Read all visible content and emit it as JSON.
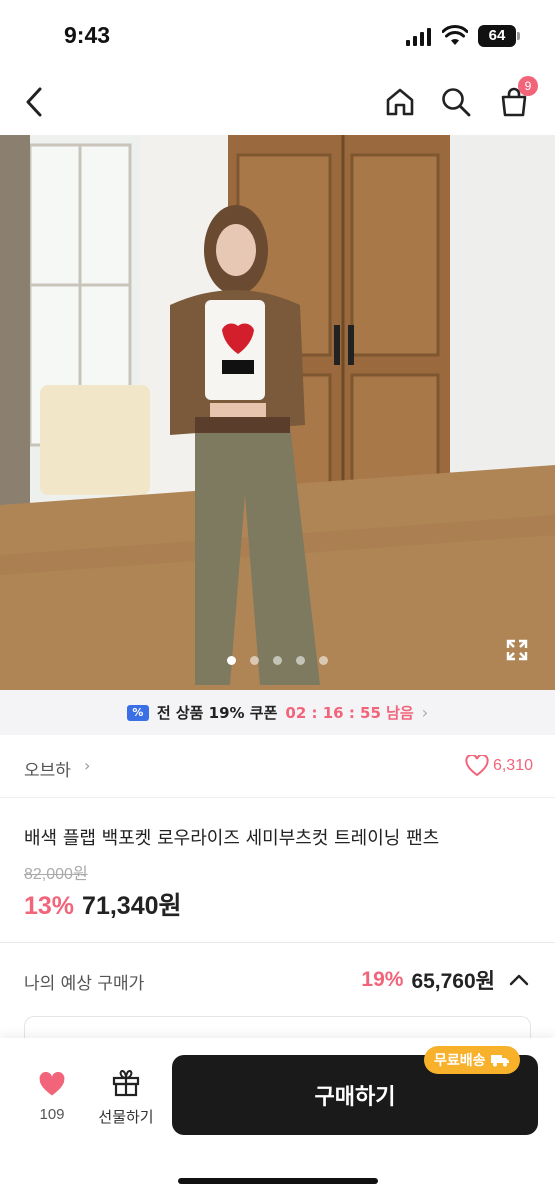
{
  "status_bar": {
    "time": "9:43",
    "battery": "64"
  },
  "nav": {
    "cart_badge": "9",
    "icons": [
      "back-icon",
      "home-icon",
      "search-icon",
      "cart-icon"
    ]
  },
  "gallery": {
    "total_images": 5,
    "current_index": 1
  },
  "coupon": {
    "text": "전 상품 19% 쿠폰",
    "timer": "02 : 16 : 55 남음",
    "arrow": "›"
  },
  "brand": {
    "name": "오브하",
    "arrow": "›",
    "likes": "6,310"
  },
  "product": {
    "title": "배색 플랩 백포켓 로우라이즈 세미부츠컷 트레이닝 팬츠",
    "original_price": "82,000원",
    "discount": "13%",
    "price": "71,340원"
  },
  "expected": {
    "label": "나의 예상 구매가",
    "discount": "19%",
    "price": "65,760원"
  },
  "bottom": {
    "wish_count": "109",
    "gift_label": "선물하기",
    "buy_label": "구매하기",
    "free_shipping": "무료배송"
  },
  "colors": {
    "accent": "#f1647a",
    "buy_button": "#1a1a1a",
    "coupon_icon": "#3b6fe6",
    "free_ship": "#f7b12b"
  }
}
